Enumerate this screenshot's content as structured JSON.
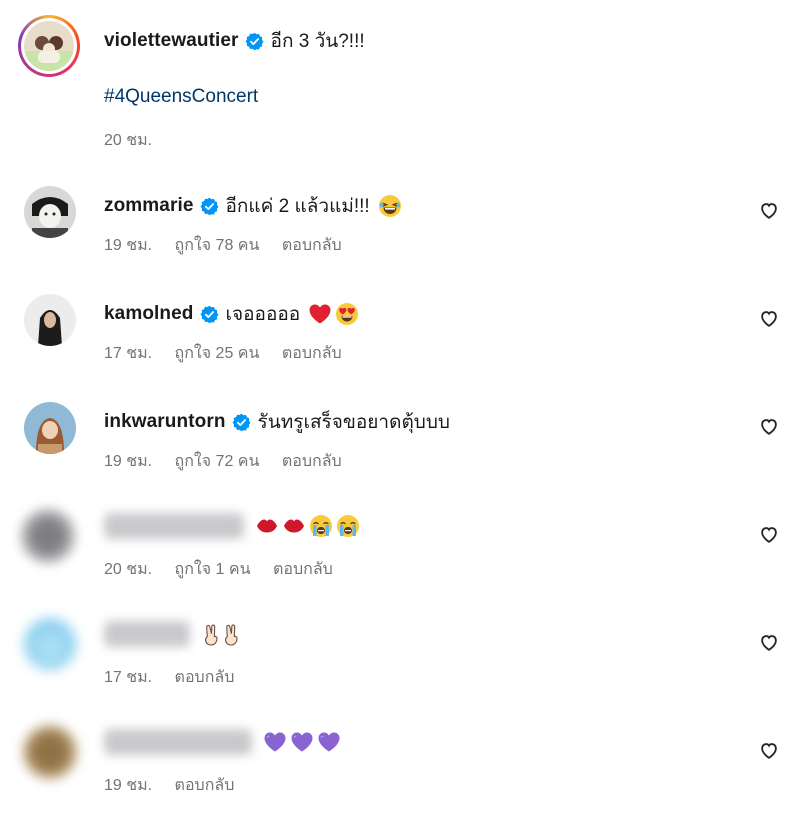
{
  "caption": {
    "username": "violettewautier",
    "text": "อีก 3 วัน?!!!",
    "hashtag": "#4QueensConcert",
    "time": "20 ชม."
  },
  "comments": [
    {
      "username": "zommarie",
      "verified": true,
      "text": "อีกแค่ 2 แล้วแม่!!!",
      "emojis": [
        "laughing-face"
      ],
      "time": "19 ชม.",
      "likes": "ถูกใจ 78 คน",
      "reply": "ตอบกลับ"
    },
    {
      "username": "kamolned",
      "verified": true,
      "text": "เจอออออ",
      "emojis": [
        "red-heart",
        "heart-eyes-face"
      ],
      "time": "17 ชม.",
      "likes": "ถูกใจ 25 คน",
      "reply": "ตอบกลับ"
    },
    {
      "username": "inkwaruntorn",
      "verified": true,
      "text": "รันทรูเสร็จขอยาดตุ้บบบ",
      "emojis": [],
      "time": "19 ชม.",
      "likes": "ถูกใจ 72 คน",
      "reply": "ตอบกลับ"
    },
    {
      "username": "",
      "verified": false,
      "text": "",
      "emojis": [
        "lips",
        "lips",
        "crying-face",
        "crying-face"
      ],
      "time": "20 ชม.",
      "likes": "ถูกใจ 1 คน",
      "reply": "ตอบกลับ"
    },
    {
      "username": "",
      "verified": false,
      "text": "",
      "emojis": [
        "victory-hand",
        "victory-hand"
      ],
      "time": "17 ชม.",
      "reply": "ตอบกลับ"
    },
    {
      "username": "",
      "verified": false,
      "text": "",
      "emojis": [
        "purple-heart",
        "purple-heart",
        "purple-heart"
      ],
      "time": "19 ชม.",
      "reply": "ตอบกลับ"
    }
  ],
  "colors": {
    "verified": "#0095f6",
    "hashtag": "#00376b",
    "meta": "#737373"
  }
}
